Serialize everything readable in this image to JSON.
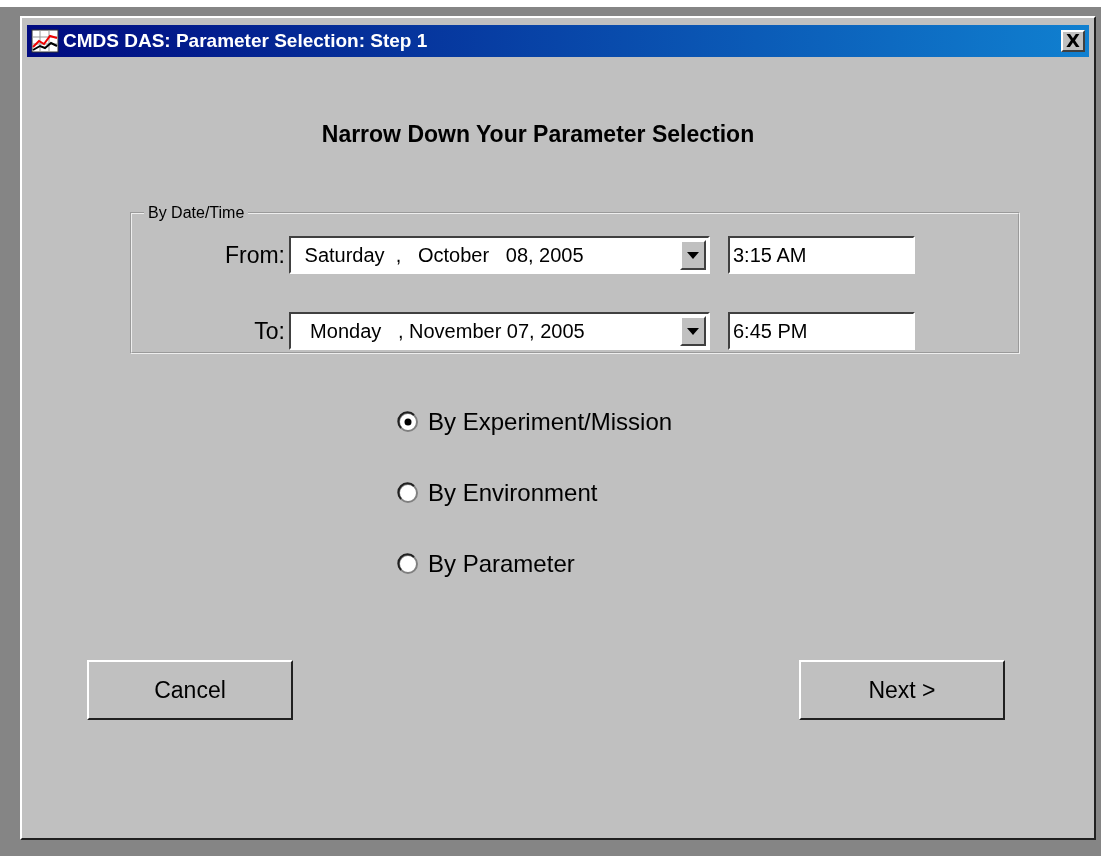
{
  "window": {
    "title": "CMDS DAS: Parameter Selection: Step 1",
    "close": "X"
  },
  "heading": "Narrow Down Your Parameter Selection",
  "date_group": {
    "legend": "By Date/Time",
    "rows": [
      {
        "label": "From:",
        "date": " Saturday  ,   October   08, 2005",
        "time": "3:15 AM"
      },
      {
        "label": "To:",
        "date": "  Monday   , November 07, 2005",
        "time": "6:45 PM"
      }
    ]
  },
  "options": [
    {
      "label": "By Experiment/Mission",
      "selected": true
    },
    {
      "label": "By Environment",
      "selected": false
    },
    {
      "label": "By Parameter",
      "selected": false
    }
  ],
  "buttons": [
    "Cancel",
    "Next >"
  ]
}
